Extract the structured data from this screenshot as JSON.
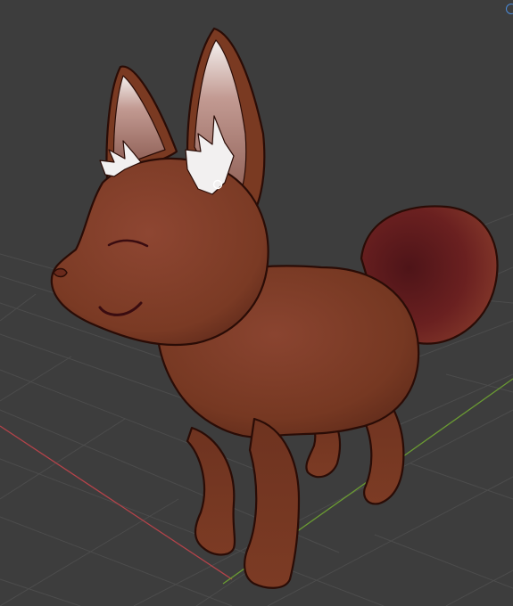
{
  "viewport": {
    "mode": "3D Viewport",
    "background": "#3d3d3d",
    "grid_color": "#4b4b4b",
    "x_axis_color": "#b4434a",
    "y_axis_color": "#6a9a33"
  },
  "object": {
    "name": "fox-character",
    "body_color": "#7a3a22",
    "outline_color": "#2a0c06",
    "tail_color": "#6e2220",
    "ear_inner_color": "#c69a92",
    "ear_fur_color": "#f2f0f0",
    "face_line_color": "#3a0c10"
  },
  "cursor": {
    "icon": "3d-cursor-icon"
  },
  "gizmo": {
    "icon": "navigation-gizmo-icon",
    "accent": "#4a8ad8"
  }
}
